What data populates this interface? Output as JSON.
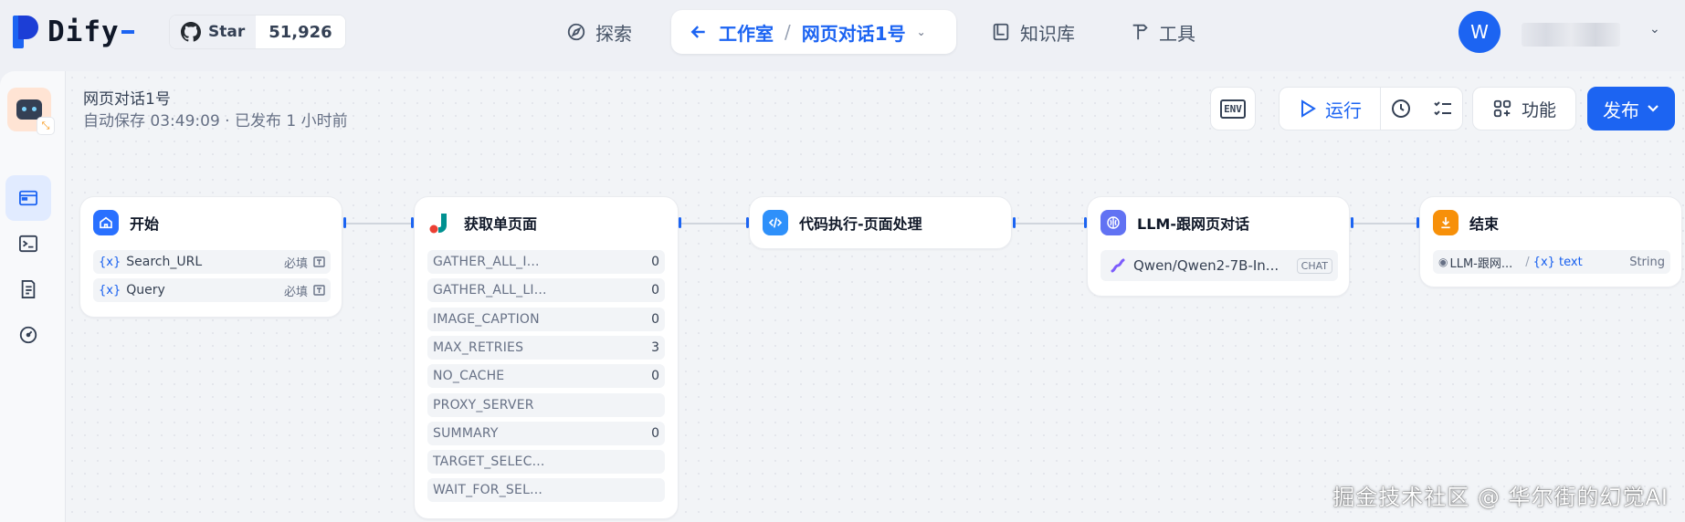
{
  "brand": {
    "name": "Dify"
  },
  "github": {
    "star_label": "Star",
    "count": "51,926"
  },
  "nav": {
    "explore": "探索",
    "breadcrumb_back": "工作室",
    "breadcrumb_sep": "/",
    "breadcrumb_current": "网页对话1号",
    "knowledge": "知识库",
    "tools": "工具"
  },
  "user": {
    "avatar_letter": "W"
  },
  "app": {
    "title": "网页对话1号",
    "status": "自动保存 03:49:09 · 已发布 1 小时前"
  },
  "toolbar": {
    "env_label": "ENV",
    "run_label": "运行",
    "features_label": "功能",
    "publish_label": "发布"
  },
  "nodes": {
    "start": {
      "title": "开始",
      "vars": [
        {
          "icon_text": "{x}",
          "name": "Search_URL",
          "required": "必填"
        },
        {
          "icon_text": "{x}",
          "name": "Query",
          "required": "必填"
        }
      ]
    },
    "fetch": {
      "title": "获取单页面",
      "params": [
        {
          "name": "GATHER_ALL_I...",
          "value": "0"
        },
        {
          "name": "GATHER_ALL_LI...",
          "value": "0"
        },
        {
          "name": "IMAGE_CAPTION",
          "value": "0"
        },
        {
          "name": "MAX_RETRIES",
          "value": "3"
        },
        {
          "name": "NO_CACHE",
          "value": "0"
        },
        {
          "name": "PROXY_SERVER",
          "value": ""
        },
        {
          "name": "SUMMARY",
          "value": "0"
        },
        {
          "name": "TARGET_SELEC...",
          "value": ""
        },
        {
          "name": "WAIT_FOR_SEL...",
          "value": ""
        }
      ]
    },
    "code": {
      "title": "代码执行-页面处理"
    },
    "llm": {
      "title": "LLM-跟网页对话",
      "model": "Qwen/Qwen2-7B-In...",
      "mode_badge": "CHAT"
    },
    "end": {
      "title": "结束",
      "output_source": "LLM-跟网...",
      "output_var": "{x} text",
      "output_type": "String"
    }
  },
  "watermark": "掘金技术社区 @ 华尔街的幻觉AI",
  "colors": {
    "accent": "#1c64f2",
    "start_icon": "#2970ff",
    "code_icon": "#2e90fa",
    "llm_icon": "#6172f3",
    "end_icon": "#f79009"
  }
}
